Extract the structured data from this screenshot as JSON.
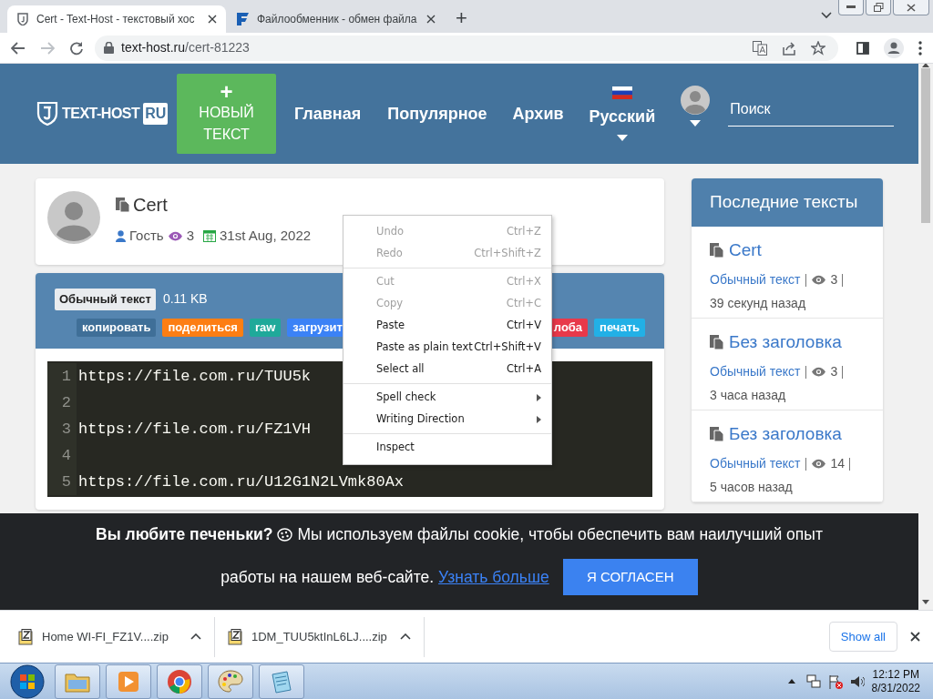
{
  "browser": {
    "tabs": [
      {
        "title": "Cert - Text-Host - текстовый хос",
        "selected": true
      },
      {
        "title": "Файлообменник - обмен файла",
        "selected": false
      }
    ],
    "new_tab": "+",
    "url_domain": "text-host.ru",
    "url_path": "/cert-81223"
  },
  "header": {
    "logo": "TEXT-HOST",
    "logo_badge": "RU",
    "new_button": {
      "icon": "+",
      "label": "НОВЫЙ ТЕКСТ"
    },
    "nav": [
      "Главная",
      "Популярное",
      "Архив"
    ],
    "language": "Русский",
    "search": {
      "placeholder": "Поиск"
    }
  },
  "post": {
    "title": "Cert",
    "author": "Гость",
    "views": "3",
    "date": "31st Aug, 2022",
    "syntax": "Обычный текст",
    "size": "0.11 KB",
    "actions": [
      {
        "label": "копировать",
        "color": "#3f6f98"
      },
      {
        "label": "поделиться",
        "color": "#fd7e14"
      },
      {
        "label": "raw",
        "color": "#1fa99a"
      },
      {
        "label": "загрузит",
        "color": "#3b82f6"
      },
      {
        "label": "лоба",
        "color": "#e8394a"
      },
      {
        "label": "печать",
        "color": "#22b0e6"
      }
    ],
    "lines": [
      {
        "number": "1",
        "text": "https://file.com.ru/TUU5k"
      },
      {
        "number": "2"
      },
      {
        "number": "3",
        "text": "https://file.com.ru/FZ1VH"
      },
      {
        "number": "4"
      },
      {
        "number": "5",
        "text": "https://file.com.ru/U12G1N2LVmk80Ax"
      }
    ]
  },
  "sidebar": {
    "title": "Последние тексты",
    "items": [
      {
        "title": "Cert",
        "syntax": "Обычный текст",
        "views": "3",
        "time": "39 секунд назад"
      },
      {
        "title": "Без заголовка",
        "syntax": "Обычный текст",
        "views": "3",
        "time": "3 часа назад"
      },
      {
        "title": "Без заголовка",
        "syntax": "Обычный текст",
        "views": "14",
        "time": "5 часов назад"
      }
    ]
  },
  "context_menu": {
    "groups": [
      {
        "items": [
          {
            "label": "Undo",
            "shortcut": "Ctrl+Z",
            "disabled": true,
            "submenu": false
          },
          {
            "label": "Redo",
            "shortcut": "Ctrl+Shift+Z",
            "disabled": true,
            "submenu": false
          }
        ]
      },
      {
        "items": [
          {
            "label": "Cut",
            "shortcut": "Ctrl+X",
            "disabled": true,
            "submenu": false
          },
          {
            "label": "Copy",
            "shortcut": "Ctrl+C",
            "disabled": true,
            "submenu": false
          },
          {
            "label": "Paste",
            "shortcut": "Ctrl+V",
            "disabled": false,
            "submenu": false
          },
          {
            "label": "Paste as plain text",
            "shortcut": "Ctrl+Shift+V",
            "disabled": false,
            "submenu": false
          },
          {
            "label": "Select all",
            "shortcut": "Ctrl+A",
            "disabled": false,
            "submenu": false
          }
        ]
      },
      {
        "items": [
          {
            "label": "Spell check",
            "disabled": false,
            "submenu": true
          },
          {
            "label": "Writing Direction",
            "disabled": false,
            "submenu": true
          }
        ]
      },
      {
        "items": [
          {
            "label": "Inspect",
            "disabled": false,
            "submenu": false
          }
        ]
      }
    ]
  },
  "cookie_banner": {
    "heading": "Вы любите печеньки?",
    "text_lines": [
      "Мы используем файлы cookie, чтобы обеспечить вам наилучший опыт",
      "работы на нашем веб-сайте."
    ],
    "link": "Узнать больше",
    "button": "Я СОГЛАСЕН"
  },
  "downloads": {
    "items": [
      {
        "name": "Home WI-FI_FZ1V....zip"
      },
      {
        "name": "1DM_TUU5ktInL6LJ....zip"
      }
    ],
    "show_all": "Show all"
  },
  "taskbar": {
    "time": "12:12 PM",
    "date": "8/31/2022"
  }
}
